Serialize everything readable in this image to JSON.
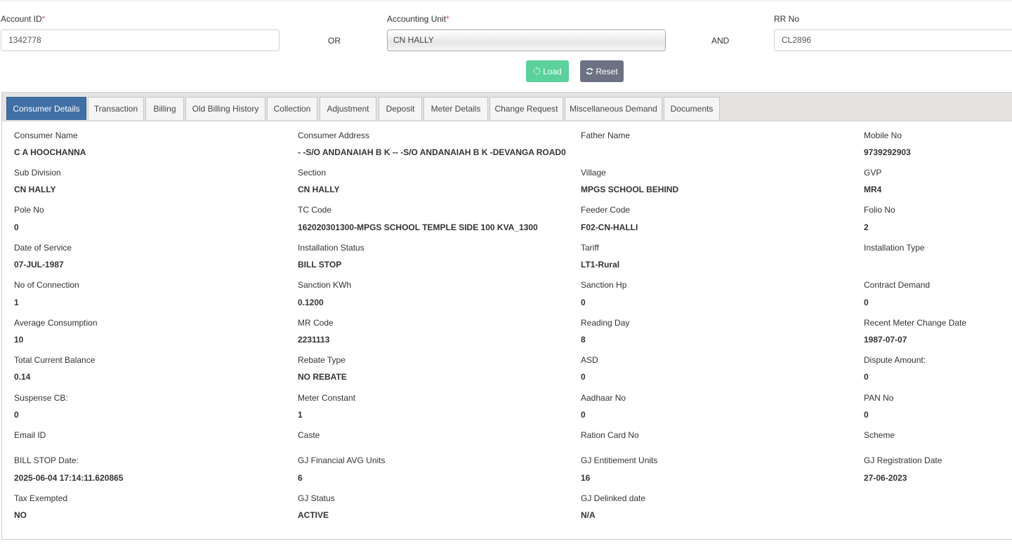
{
  "search": {
    "account_id_label": "Account ID",
    "account_id_value": "1342778",
    "or_label": "OR",
    "accounting_unit_label": "Accounting Unit",
    "accounting_unit_value": "CN HALLY",
    "and_label": "AND",
    "rr_no_label": "RR No",
    "rr_no_value": "CL2896",
    "required_mark": "*",
    "load_label": "Load",
    "reset_label": "Reset"
  },
  "tabs": [
    {
      "label": "Consumer Details",
      "active": true
    },
    {
      "label": "Transaction"
    },
    {
      "label": "Billing"
    },
    {
      "label": "Old Billing History"
    },
    {
      "label": "Collection"
    },
    {
      "label": "Adjustment"
    },
    {
      "label": "Deposit"
    },
    {
      "label": "Meter Details"
    },
    {
      "label": "Change Request"
    },
    {
      "label": "Miscellaneous Demand"
    },
    {
      "label": "Documents"
    }
  ],
  "details": [
    [
      {
        "label": "Consumer Name",
        "value": "C A HOOCHANNA"
      },
      {
        "label": "Consumer Address",
        "value": "- -S/O ANDANAIAH B K -- -S/O ANDANAIAH B K -DEVANGA ROAD0"
      },
      {
        "label": "Father Name",
        "value": ""
      },
      {
        "label": "Mobile No",
        "value": "9739292903"
      }
    ],
    [
      {
        "label": "Sub Division",
        "value": "CN HALLY"
      },
      {
        "label": "Section",
        "value": "CN HALLY"
      },
      {
        "label": "Village",
        "value": "MPGS SCHOOL BEHIND"
      },
      {
        "label": "GVP",
        "value": "MR4"
      }
    ],
    [
      {
        "label": "Pole No",
        "value": "0"
      },
      {
        "label": "TC Code",
        "value": "162020301300-MPGS SCHOOL TEMPLE SIDE 100 KVA_1300"
      },
      {
        "label": "Feeder Code",
        "value": "F02-CN-HALLI"
      },
      {
        "label": "Folio No",
        "value": "2"
      }
    ],
    [
      {
        "label": "Date of Service",
        "value": "07-JUL-1987"
      },
      {
        "label": "Installation Status",
        "value": "BILL STOP"
      },
      {
        "label": "Tariff",
        "value": "LT1-Rural"
      },
      {
        "label": "Installation Type",
        "value": ""
      }
    ],
    [
      {
        "label": "No of Connection",
        "value": "1"
      },
      {
        "label": "Sanction KWh",
        "value": "0.1200"
      },
      {
        "label": "Sanction Hp",
        "value": "0"
      },
      {
        "label": "Contract Demand",
        "value": "0"
      }
    ],
    [
      {
        "label": "Average Consumption",
        "value": "10"
      },
      {
        "label": "MR Code",
        "value": "2231113"
      },
      {
        "label": "Reading Day",
        "value": "8"
      },
      {
        "label": "Recent Meter Change Date",
        "value": "1987-07-07"
      }
    ],
    [
      {
        "label": "Total Current Balance",
        "value": "0.14"
      },
      {
        "label": "Rebate Type",
        "value": "NO REBATE"
      },
      {
        "label": "ASD",
        "value": "0"
      },
      {
        "label": "Dispute Amount:",
        "value": "0"
      }
    ],
    [
      {
        "label": "Suspense CB:",
        "value": "0"
      },
      {
        "label": "Meter Constant",
        "value": "1"
      },
      {
        "label": "Aadhaar No",
        "value": "0"
      },
      {
        "label": "PAN No",
        "value": "0"
      }
    ],
    [
      {
        "label": "Email ID",
        "value": ""
      },
      {
        "label": "Caste",
        "value": ""
      },
      {
        "label": "Ration Card No",
        "value": ""
      },
      {
        "label": "Scheme",
        "value": ""
      }
    ],
    [
      {
        "label": "BILL STOP Date:",
        "value": "2025-06-04 17:14:11.620865"
      },
      {
        "label": "GJ Financial AVG Units",
        "value": "6"
      },
      {
        "label": "GJ Entitiement Units",
        "value": "16"
      },
      {
        "label": "GJ Registration Date",
        "value": "27-06-2023"
      }
    ],
    [
      {
        "label": "Tax Exempted",
        "value": "NO"
      },
      {
        "label": "GJ Status",
        "value": "ACTIVE"
      },
      {
        "label": "GJ Delinked date",
        "value": "N/A"
      }
    ]
  ]
}
